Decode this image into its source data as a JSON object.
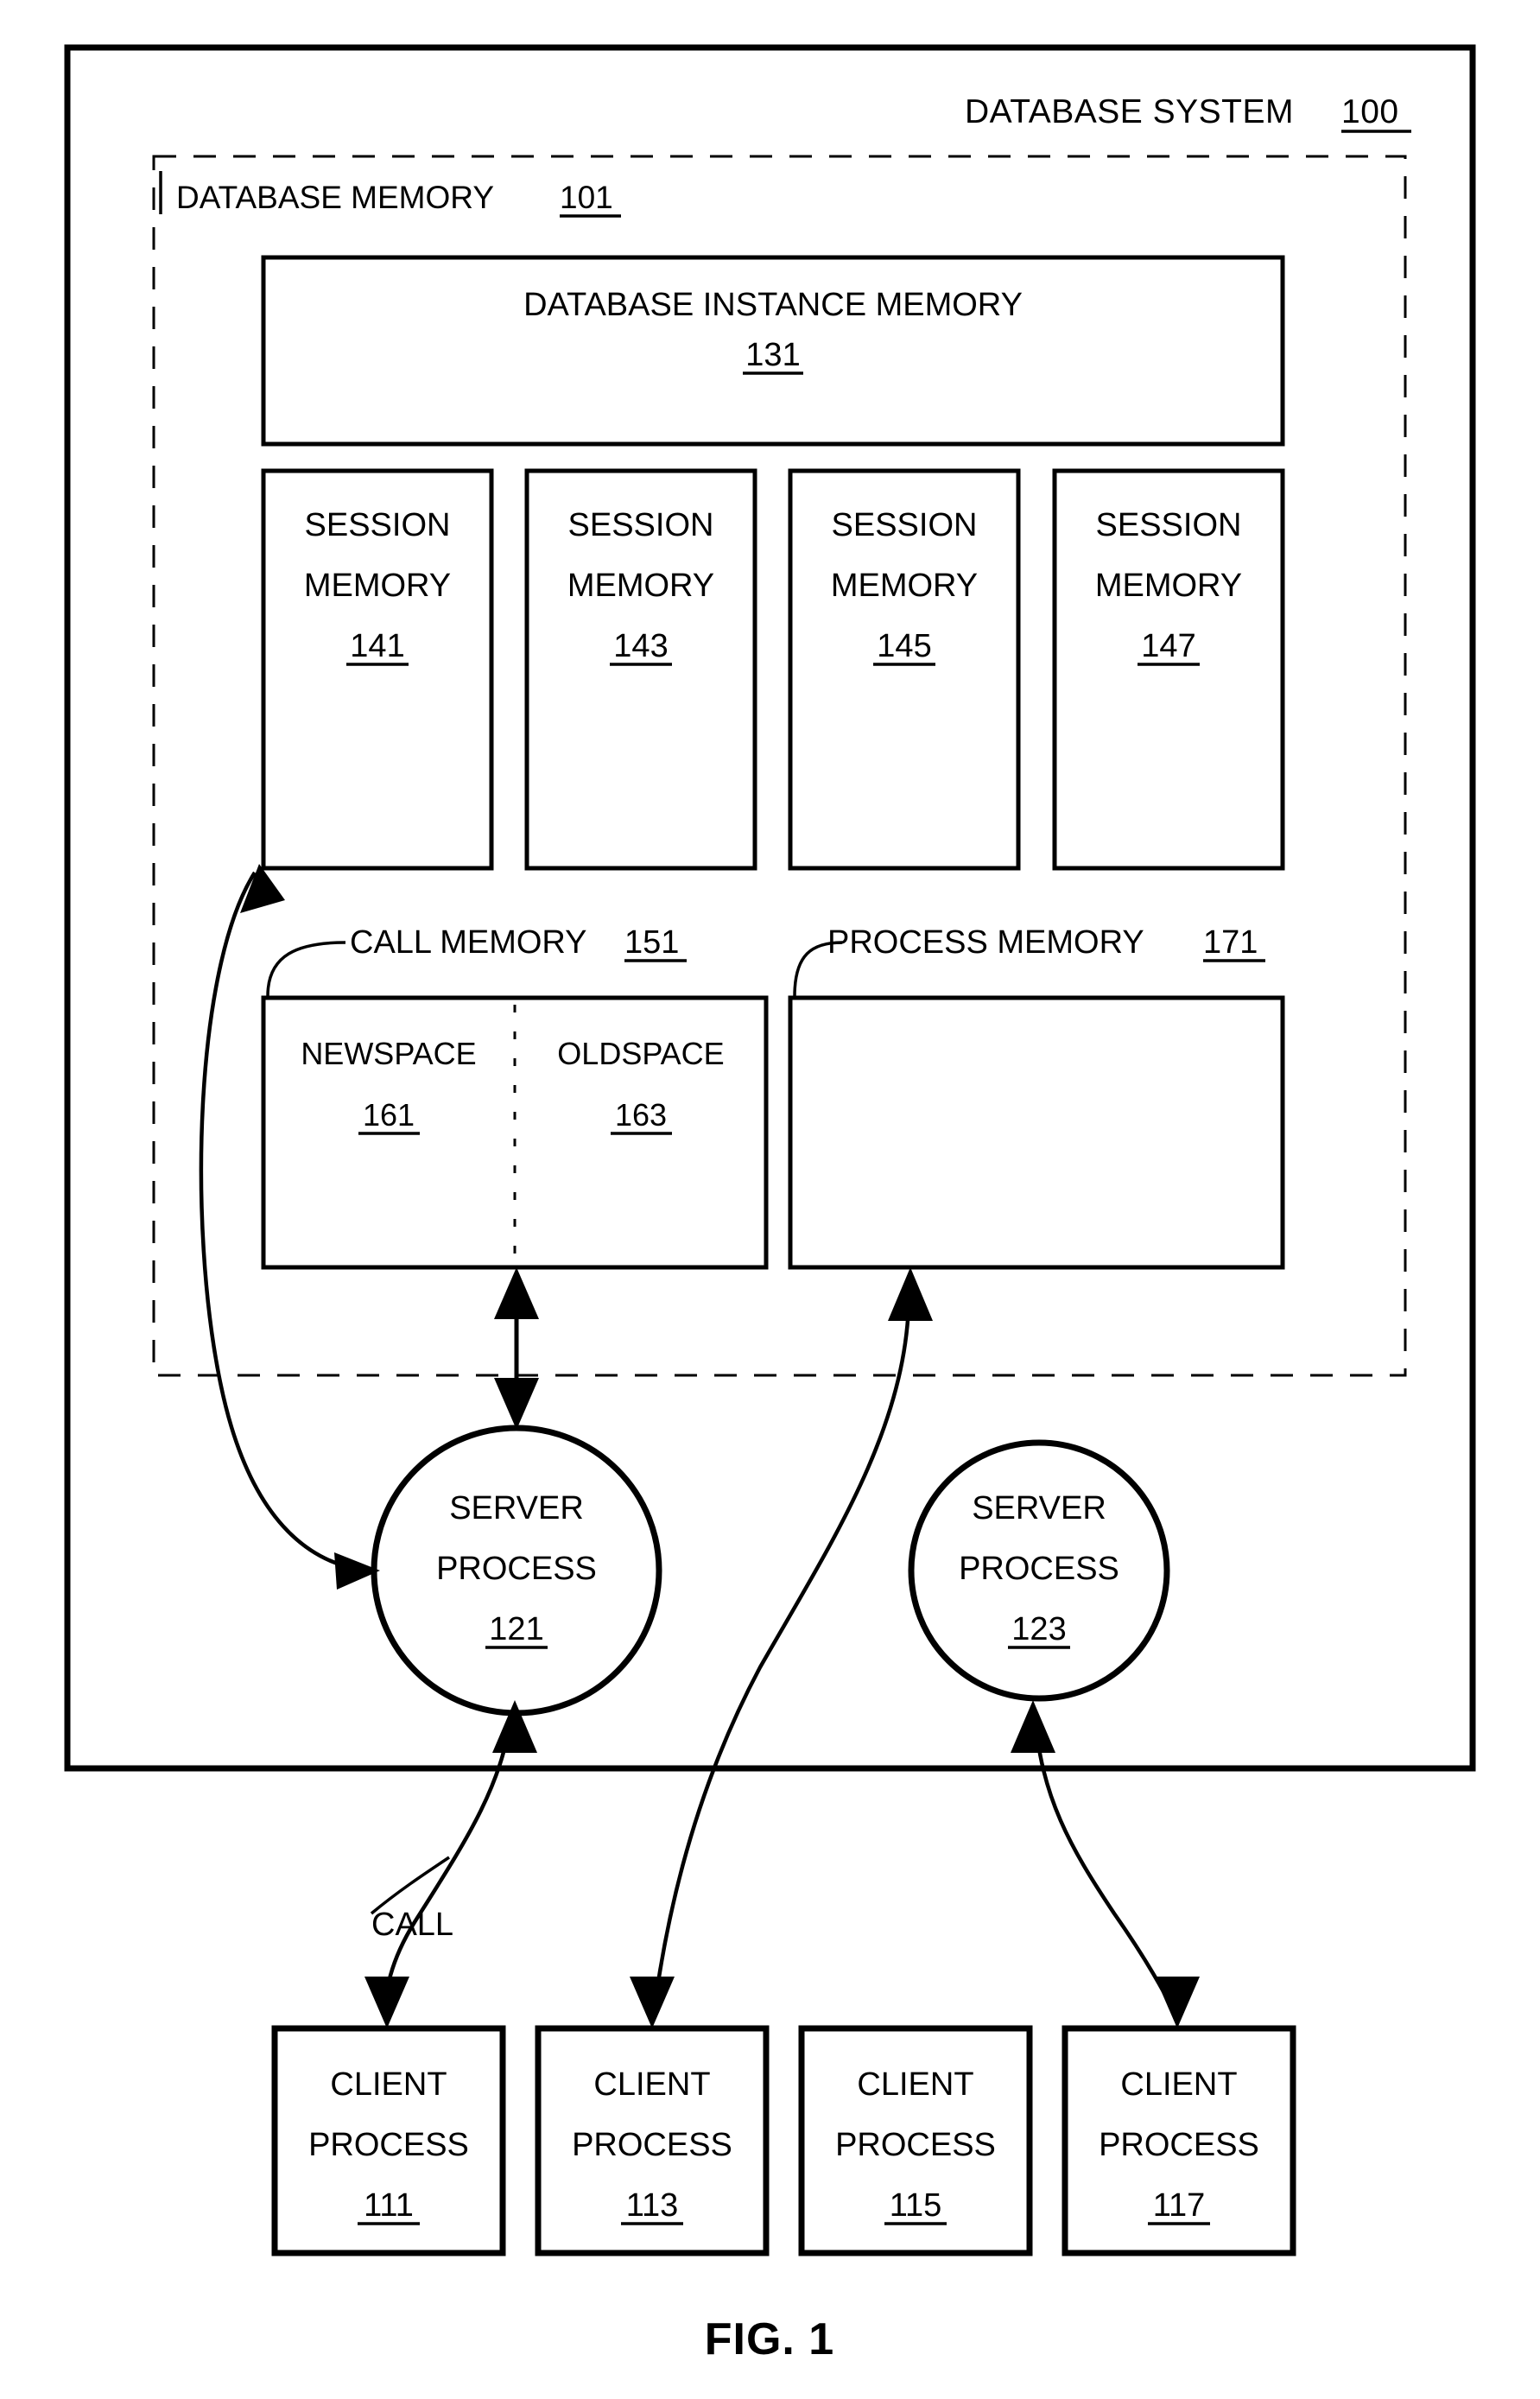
{
  "figure": {
    "caption": "FIG. 1",
    "system_label": "DATABASE SYSTEM",
    "system_ref": "100",
    "memory_region_label": "DATABASE MEMORY",
    "memory_region_ref": "101"
  },
  "instance_memory": {
    "label": "DATABASE INSTANCE MEMORY",
    "ref": "131"
  },
  "session_memories": [
    {
      "line1": "SESSION",
      "line2": "MEMORY",
      "ref": "141"
    },
    {
      "line1": "SESSION",
      "line2": "MEMORY",
      "ref": "143"
    },
    {
      "line1": "SESSION",
      "line2": "MEMORY",
      "ref": "145"
    },
    {
      "line1": "SESSION",
      "line2": "MEMORY",
      "ref": "147"
    }
  ],
  "call_memory": {
    "label": "CALL MEMORY",
    "ref": "151",
    "newspace": {
      "label": "NEWSPACE",
      "ref": "161"
    },
    "oldspace": {
      "label": "OLDSPACE",
      "ref": "163"
    }
  },
  "process_memory": {
    "label": "PROCESS MEMORY",
    "ref": "171"
  },
  "server_processes": [
    {
      "line1": "SERVER",
      "line2": "PROCESS",
      "ref": "121"
    },
    {
      "line1": "SERVER",
      "line2": "PROCESS",
      "ref": "123"
    }
  ],
  "client_processes": [
    {
      "line1": "CLIENT",
      "line2": "PROCESS",
      "ref": "111"
    },
    {
      "line1": "CLIENT",
      "line2": "PROCESS",
      "ref": "113"
    },
    {
      "line1": "CLIENT",
      "line2": "PROCESS",
      "ref": "115"
    },
    {
      "line1": "CLIENT",
      "line2": "PROCESS",
      "ref": "117"
    }
  ],
  "annotations": {
    "call_arrow_label": "CALL"
  },
  "colors": {
    "background": "#ffffff",
    "stroke": "#000000"
  }
}
